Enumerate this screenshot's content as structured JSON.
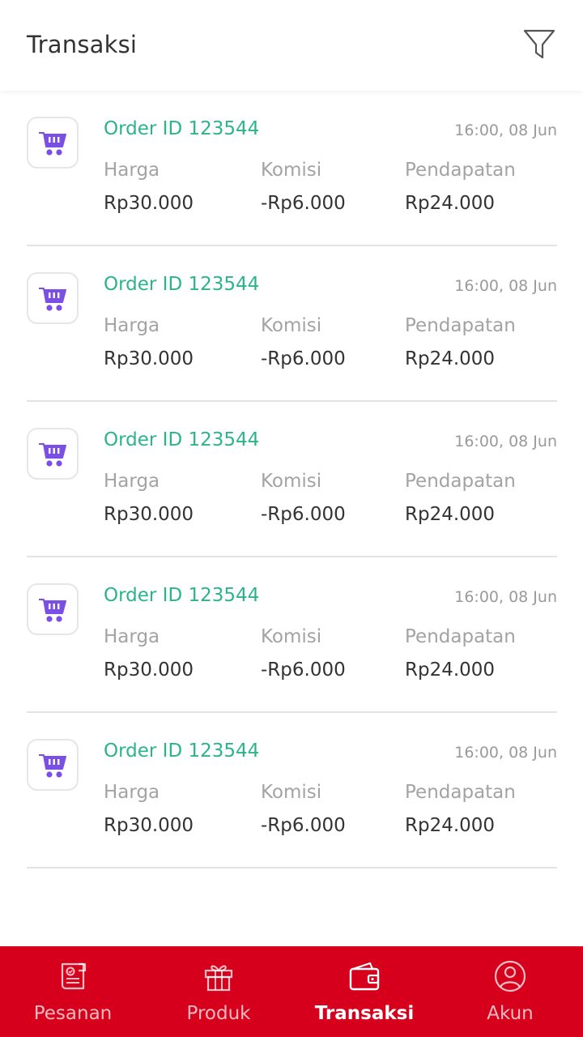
{
  "header": {
    "title": "Transaksi",
    "filter_icon": "filter-icon"
  },
  "colors": {
    "accent_green": "#2bb48a",
    "icon_purple": "#7b4fe6",
    "nav_red": "#d6001c"
  },
  "transactions": [
    {
      "order_id": "Order ID 123544",
      "time": "16:00, 08 Jun",
      "price_label": "Harga",
      "price": "Rp30.000",
      "commission_label": "Komisi",
      "commission": "-Rp6.000",
      "income_label": "Pendapatan",
      "income": "Rp24.000",
      "icon": "shopping-cart-icon"
    },
    {
      "order_id": "Order ID 123544",
      "time": "16:00, 08 Jun",
      "price_label": "Harga",
      "price": "Rp30.000",
      "commission_label": "Komisi",
      "commission": "-Rp6.000",
      "income_label": "Pendapatan",
      "income": "Rp24.000",
      "icon": "shopping-cart-icon"
    },
    {
      "order_id": "Order ID 123544",
      "time": "16:00, 08 Jun",
      "price_label": "Harga",
      "price": "Rp30.000",
      "commission_label": "Komisi",
      "commission": "-Rp6.000",
      "income_label": "Pendapatan",
      "income": "Rp24.000",
      "icon": "shopping-cart-icon"
    },
    {
      "order_id": "Order ID 123544",
      "time": "16:00, 08 Jun",
      "price_label": "Harga",
      "price": "Rp30.000",
      "commission_label": "Komisi",
      "commission": "-Rp6.000",
      "income_label": "Pendapatan",
      "income": "Rp24.000",
      "icon": "shopping-cart-icon"
    },
    {
      "order_id": "Order ID 123544",
      "time": "16:00, 08 Jun",
      "price_label": "Harga",
      "price": "Rp30.000",
      "commission_label": "Komisi",
      "commission": "-Rp6.000",
      "income_label": "Pendapatan",
      "income": "Rp24.000",
      "icon": "shopping-cart-icon"
    }
  ],
  "bottom_nav": {
    "items": [
      {
        "label": "Pesanan",
        "icon": "order-receipt-icon",
        "active": false
      },
      {
        "label": "Produk",
        "icon": "gift-box-icon",
        "active": false
      },
      {
        "label": "Transaksi",
        "icon": "wallet-icon",
        "active": true
      },
      {
        "label": "Akun",
        "icon": "user-account-icon",
        "active": false
      }
    ]
  }
}
